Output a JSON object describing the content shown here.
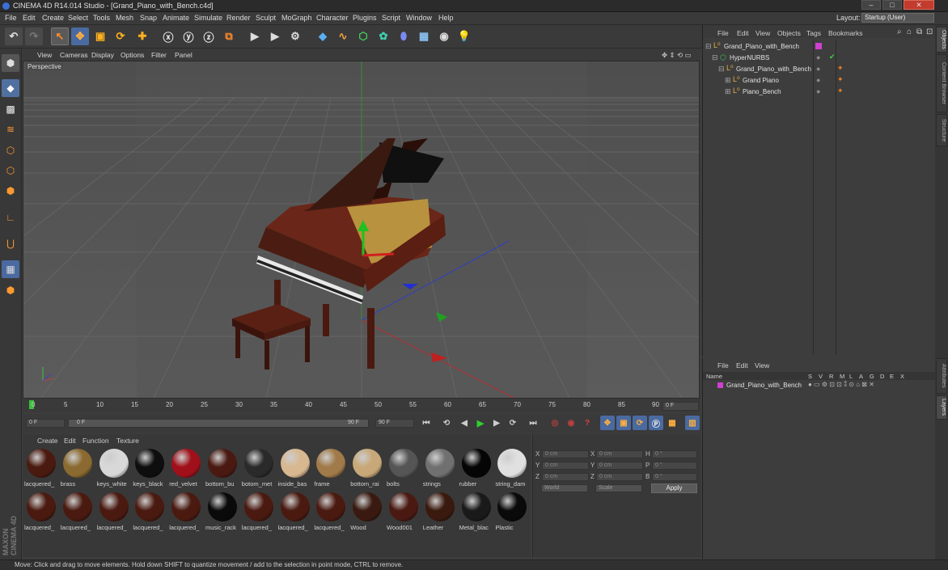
{
  "window": {
    "title": "CINEMA 4D R14.014 Studio - [Grand_Piano_with_Bench.c4d]",
    "minimize": "–",
    "maximize": "□",
    "close": "✕"
  },
  "menubar": {
    "items": [
      "File",
      "Edit",
      "Create",
      "Select",
      "Tools",
      "Mesh",
      "Snap",
      "Animate",
      "Simulate",
      "Render",
      "Sculpt",
      "MoGraph",
      "Character",
      "Plugins",
      "Script",
      "Window",
      "Help"
    ],
    "layout_label": "Layout:",
    "layout_value": "Startup (User)"
  },
  "viewport": {
    "menu": [
      "View",
      "Cameras",
      "Display",
      "Options",
      "Filter",
      "Panel"
    ],
    "label": "Perspective"
  },
  "timeline": {
    "ticks": [
      "0",
      "5",
      "10",
      "15",
      "20",
      "25",
      "30",
      "35",
      "40",
      "45",
      "50",
      "55",
      "60",
      "65",
      "70",
      "75",
      "80",
      "85",
      "90"
    ],
    "current_frame": "0 F"
  },
  "transport": {
    "start": "0 F",
    "range_start": "0 F",
    "range_end": "90 F",
    "end": "90 F"
  },
  "materials": {
    "menu": [
      "Create",
      "Edit",
      "Function",
      "Texture"
    ],
    "row1": [
      {
        "name": "lacquered_",
        "color": "#4a1a10"
      },
      {
        "name": "brass",
        "color": "#8a6a30"
      },
      {
        "name": "keys_white",
        "color": "#d8d8d8"
      },
      {
        "name": "keys_black",
        "color": "#0e0e0e"
      },
      {
        "name": "red_velvet",
        "color": "#a0101a"
      },
      {
        "name": "bottom_bu",
        "color": "#4a1a12"
      },
      {
        "name": "botom_met",
        "color": "#2a2a2a"
      },
      {
        "name": "inside_bas",
        "color": "#d8b890"
      },
      {
        "name": "frame",
        "color": "#a07a48"
      },
      {
        "name": "bottom_rai",
        "color": "#c8a878"
      },
      {
        "name": "bolts",
        "color": "#555555"
      },
      {
        "name": "strings",
        "color": "#707070"
      },
      {
        "name": "rubber",
        "color": "#050505"
      },
      {
        "name": "string_dam",
        "color": "#e0e0e0"
      }
    ],
    "row2": [
      {
        "name": "lacquered_",
        "color": "#4a1a10"
      },
      {
        "name": "lacquered_",
        "color": "#4a1a10"
      },
      {
        "name": "lacquered_",
        "color": "#4a1a10"
      },
      {
        "name": "lacquered_",
        "color": "#4a1a10"
      },
      {
        "name": "lacquered_",
        "color": "#4a1a10"
      },
      {
        "name": "music_rack",
        "color": "#0a0a0a"
      },
      {
        "name": "lacquered_",
        "color": "#4a1a10"
      },
      {
        "name": "lacquered_",
        "color": "#4a1a10"
      },
      {
        "name": "lacquered_",
        "color": "#4a1a10"
      },
      {
        "name": "Wood",
        "color": "#3a1a10"
      },
      {
        "name": "Wood001",
        "color": "#4a1a12"
      },
      {
        "name": "Leather",
        "color": "#3a1a0e"
      },
      {
        "name": "Metal_blac",
        "color": "#1a1a1a"
      },
      {
        "name": "Plastic",
        "color": "#0a0a0a"
      }
    ]
  },
  "coords": {
    "x1": "0 cm",
    "y1": "0 cm",
    "z1": "0 cm",
    "x2": "0 cm",
    "y2": "0 cm",
    "z2": "0 cm",
    "h": "0 °",
    "p": "0 °",
    "b": "0 °",
    "labels": {
      "x": "X",
      "y": "Y",
      "z": "Z",
      "h": "H",
      "p": "P",
      "b": "B"
    },
    "world": "World",
    "scale": "Scale",
    "apply": "Apply"
  },
  "objects": {
    "menu": [
      "File",
      "Edit",
      "View",
      "Objects",
      "Tags",
      "Bookmarks"
    ],
    "tree": [
      {
        "name": "Grand_Piano_with_Bench"
      },
      {
        "name": "HyperNURBS"
      },
      {
        "name": "Grand_Piano_with_Bench"
      },
      {
        "name": "Grand Piano"
      },
      {
        "name": "Piano_Bench"
      }
    ]
  },
  "layers": {
    "menu": [
      "File",
      "Edit",
      "View"
    ],
    "header_name": "Name",
    "cols": [
      "S",
      "V",
      "R",
      "M",
      "L",
      "A",
      "G",
      "D",
      "E",
      "X"
    ],
    "row": "Grand_Piano_with_Bench"
  },
  "sidetabs": [
    "Objects",
    "Content Browser",
    "Structure",
    "Attributes",
    "Layers"
  ],
  "status": "Move: Click and drag to move elements. Hold down SHIFT to quantize movement / add to the selection in point mode, CTRL to remove.",
  "brand": {
    "maxon": "MAXON",
    "c4d": "CINEMA 4D"
  }
}
